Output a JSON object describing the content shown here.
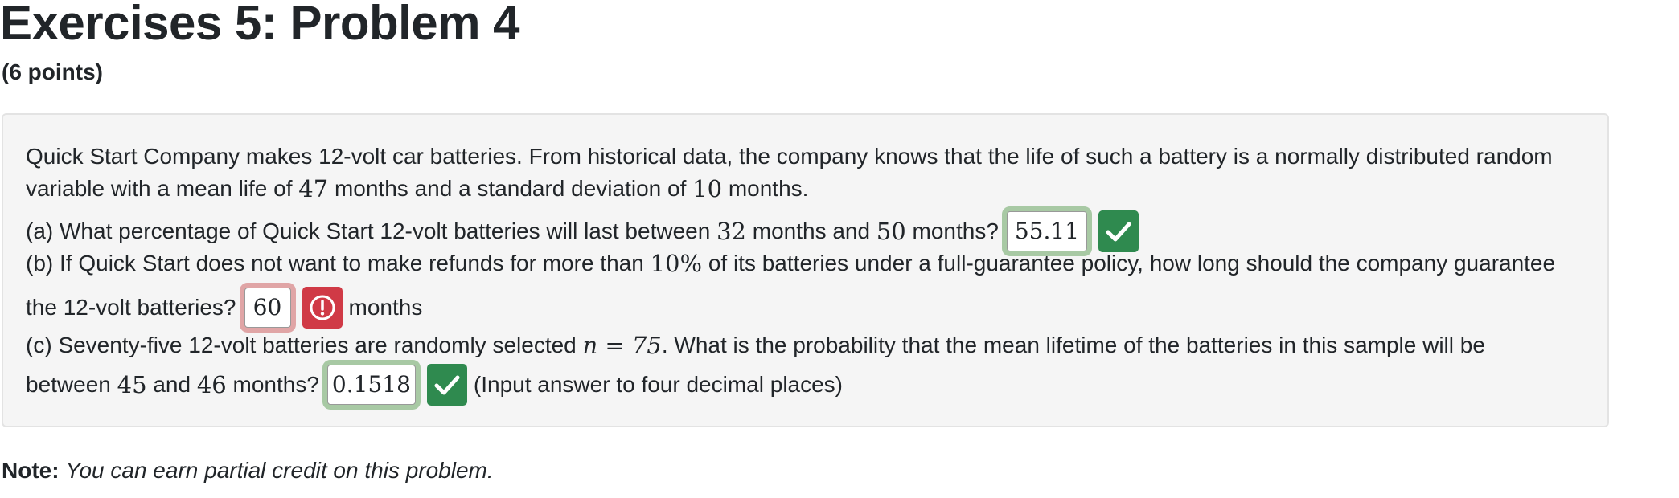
{
  "header": {
    "title": "Exercises 5: Problem 4",
    "points": "(6 points)"
  },
  "problem": {
    "intro_line1": "Quick Start Company makes 12-volt car batteries. From historical data, the company knows that the life of such a battery is a normally distributed random",
    "intro_line2_a": "variable with a mean life of ",
    "mean": "47",
    "intro_line2_b": " months and a standard deviation of ",
    "sd": "10",
    "intro_line2_c": " months.",
    "part_a": {
      "text_a": "(a) What percentage of Quick Start 12-volt batteries will last between ",
      "low": "32",
      "text_b": " months and ",
      "high": "50",
      "text_c": " months?",
      "answer": "55.11",
      "status": "correct"
    },
    "part_b": {
      "text_a": "(b) If Quick Start does not want to make refunds for more than ",
      "percent": "10%",
      "text_b": " of its batteries under a full-guarantee policy, how long should the company guarantee",
      "text_c": "the 12-volt batteries?",
      "answer": "60",
      "status": "incorrect",
      "unit": "months"
    },
    "part_c": {
      "text_a": "(c) Seventy-five 12-volt batteries are randomly selected ",
      "n_expr": "n = 75",
      "text_b": ". What is the probability that the mean lifetime of the batteries in this sample will be",
      "text_c": "between ",
      "low": "45",
      "text_d": " and ",
      "high": "46",
      "text_e": " months?",
      "answer": "0.1518",
      "status": "correct",
      "hint": "(Input answer to four decimal places)"
    }
  },
  "note": {
    "label": "Note:",
    "text": "You can earn partial credit on this problem."
  },
  "colors": {
    "correct": "#2f8a4f",
    "incorrect": "#d03a46",
    "panel_bg": "#f5f5f5"
  },
  "icons": {
    "correct": "check-icon",
    "incorrect": "exclamation-circle-icon"
  }
}
